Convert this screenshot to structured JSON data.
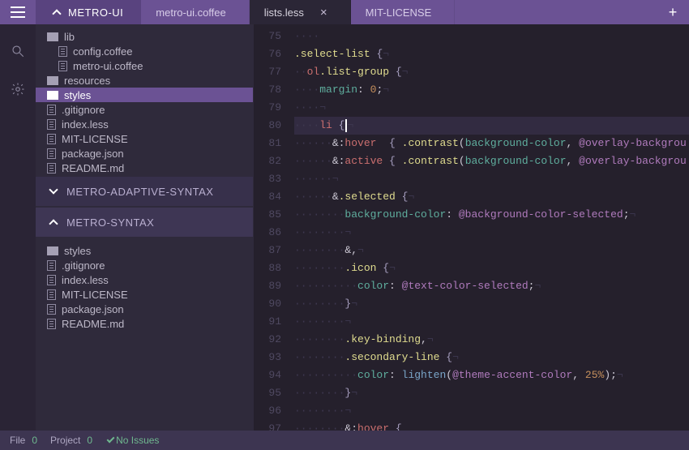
{
  "project": {
    "name": "METRO-UI"
  },
  "tabs": [
    {
      "label": "metro-ui.coffee",
      "active": false,
      "closeable": false
    },
    {
      "label": "lists.less",
      "active": true,
      "closeable": true
    },
    {
      "label": "MIT-LICENSE",
      "active": false,
      "closeable": false
    }
  ],
  "tree_top": [
    {
      "type": "folder",
      "depth": 0,
      "label": "lib"
    },
    {
      "type": "file",
      "depth": 1,
      "label": "config.coffee"
    },
    {
      "type": "file",
      "depth": 1,
      "label": "metro-ui.coffee"
    },
    {
      "type": "folder",
      "depth": 0,
      "label": "resources"
    },
    {
      "type": "folder",
      "depth": 0,
      "label": "styles",
      "selected": true
    },
    {
      "type": "file",
      "depth": 0,
      "label": ".gitignore"
    },
    {
      "type": "file",
      "depth": 0,
      "label": "index.less"
    },
    {
      "type": "file",
      "depth": 0,
      "label": "MIT-LICENSE"
    },
    {
      "type": "file",
      "depth": 0,
      "label": "package.json"
    },
    {
      "type": "file",
      "depth": 0,
      "label": "README.md"
    }
  ],
  "sections": [
    {
      "label": "METRO-ADAPTIVE-SYNTAX",
      "collapsed": true
    },
    {
      "label": "METRO-SYNTAX",
      "collapsed": false
    }
  ],
  "tree_bottom": [
    {
      "type": "folder",
      "depth": 0,
      "label": "styles"
    },
    {
      "type": "file",
      "depth": 0,
      "label": ".gitignore"
    },
    {
      "type": "file",
      "depth": 0,
      "label": "index.less"
    },
    {
      "type": "file",
      "depth": 0,
      "label": "MIT-LICENSE"
    },
    {
      "type": "file",
      "depth": 0,
      "label": "package.json"
    },
    {
      "type": "file",
      "depth": 0,
      "label": "README.md"
    }
  ],
  "editor": {
    "lines": [
      {
        "n": 75,
        "tokens": [
          {
            "t": "inv",
            "v": "····"
          },
          {
            "t": "",
            "v": ""
          }
        ]
      },
      {
        "n": 76,
        "tokens": [
          {
            "t": "cls",
            "v": ".select-list"
          },
          {
            "t": "",
            "v": " "
          },
          {
            "t": "br",
            "v": "{"
          },
          {
            "t": "inv",
            "v": "¬"
          }
        ]
      },
      {
        "n": 77,
        "tokens": [
          {
            "t": "inv",
            "v": "··"
          },
          {
            "t": "tag",
            "v": "ol"
          },
          {
            "t": "cls",
            "v": ".list-group"
          },
          {
            "t": "",
            "v": " "
          },
          {
            "t": "br",
            "v": "{"
          },
          {
            "t": "inv",
            "v": "¬"
          }
        ]
      },
      {
        "n": 78,
        "tokens": [
          {
            "t": "inv",
            "v": "····"
          },
          {
            "t": "prop",
            "v": "margin"
          },
          {
            "t": "",
            "v": ": "
          },
          {
            "t": "num",
            "v": "0"
          },
          {
            "t": "",
            "v": ";"
          },
          {
            "t": "inv",
            "v": "¬"
          }
        ]
      },
      {
        "n": 79,
        "tokens": [
          {
            "t": "inv",
            "v": "····¬"
          }
        ]
      },
      {
        "n": 80,
        "hl": true,
        "tokens": [
          {
            "t": "inv",
            "v": "····"
          },
          {
            "t": "tag",
            "v": "li"
          },
          {
            "t": "",
            "v": " "
          },
          {
            "t": "br",
            "v": "{"
          },
          {
            "t": "cursor",
            "v": ""
          },
          {
            "t": "inv",
            "v": "¬"
          }
        ]
      },
      {
        "n": 81,
        "tokens": [
          {
            "t": "inv",
            "v": "······"
          },
          {
            "t": "",
            "v": "&:"
          },
          {
            "t": "tag",
            "v": "hover"
          },
          {
            "t": "",
            "v": "  "
          },
          {
            "t": "br",
            "v": "{"
          },
          {
            "t": "",
            "v": " "
          },
          {
            "t": "cls",
            "v": ".contrast"
          },
          {
            "t": "",
            "v": "("
          },
          {
            "t": "prop",
            "v": "background-color"
          },
          {
            "t": "",
            "v": ", "
          },
          {
            "t": "var",
            "v": "@overlay-backgrou"
          }
        ]
      },
      {
        "n": 82,
        "tokens": [
          {
            "t": "inv",
            "v": "······"
          },
          {
            "t": "",
            "v": "&:"
          },
          {
            "t": "tag",
            "v": "active"
          },
          {
            "t": "",
            "v": " "
          },
          {
            "t": "br",
            "v": "{"
          },
          {
            "t": "",
            "v": " "
          },
          {
            "t": "cls",
            "v": ".contrast"
          },
          {
            "t": "",
            "v": "("
          },
          {
            "t": "prop",
            "v": "background-color"
          },
          {
            "t": "",
            "v": ", "
          },
          {
            "t": "var",
            "v": "@overlay-backgrou"
          }
        ]
      },
      {
        "n": 83,
        "tokens": [
          {
            "t": "inv",
            "v": "······¬"
          }
        ]
      },
      {
        "n": 84,
        "tokens": [
          {
            "t": "inv",
            "v": "······"
          },
          {
            "t": "",
            "v": "&"
          },
          {
            "t": "cls",
            "v": ".selected"
          },
          {
            "t": "",
            "v": " "
          },
          {
            "t": "br",
            "v": "{"
          },
          {
            "t": "inv",
            "v": "¬"
          }
        ]
      },
      {
        "n": 85,
        "tokens": [
          {
            "t": "inv",
            "v": "········"
          },
          {
            "t": "prop",
            "v": "background-color"
          },
          {
            "t": "",
            "v": ": "
          },
          {
            "t": "var",
            "v": "@background-color-selected"
          },
          {
            "t": "",
            "v": ";"
          },
          {
            "t": "inv",
            "v": "¬"
          }
        ]
      },
      {
        "n": 86,
        "tokens": [
          {
            "t": "inv",
            "v": "········¬"
          }
        ]
      },
      {
        "n": 87,
        "tokens": [
          {
            "t": "inv",
            "v": "········"
          },
          {
            "t": "",
            "v": "&,"
          },
          {
            "t": "inv",
            "v": "¬"
          }
        ]
      },
      {
        "n": 88,
        "tokens": [
          {
            "t": "inv",
            "v": "········"
          },
          {
            "t": "cls",
            "v": ".icon"
          },
          {
            "t": "",
            "v": " "
          },
          {
            "t": "br",
            "v": "{"
          },
          {
            "t": "inv",
            "v": "¬"
          }
        ]
      },
      {
        "n": 89,
        "tokens": [
          {
            "t": "inv",
            "v": "··········"
          },
          {
            "t": "prop",
            "v": "color"
          },
          {
            "t": "",
            "v": ": "
          },
          {
            "t": "var",
            "v": "@text-color-selected"
          },
          {
            "t": "",
            "v": ";"
          },
          {
            "t": "inv",
            "v": "¬"
          }
        ]
      },
      {
        "n": 90,
        "tokens": [
          {
            "t": "inv",
            "v": "········"
          },
          {
            "t": "br",
            "v": "}"
          },
          {
            "t": "inv",
            "v": "¬"
          }
        ]
      },
      {
        "n": 91,
        "tokens": [
          {
            "t": "inv",
            "v": "········¬"
          }
        ]
      },
      {
        "n": 92,
        "tokens": [
          {
            "t": "inv",
            "v": "········"
          },
          {
            "t": "cls",
            "v": ".key-binding"
          },
          {
            "t": "",
            "v": ","
          },
          {
            "t": "inv",
            "v": "¬"
          }
        ]
      },
      {
        "n": 93,
        "tokens": [
          {
            "t": "inv",
            "v": "········"
          },
          {
            "t": "cls",
            "v": ".secondary-line"
          },
          {
            "t": "",
            "v": " "
          },
          {
            "t": "br",
            "v": "{"
          },
          {
            "t": "inv",
            "v": "¬"
          }
        ]
      },
      {
        "n": 94,
        "tokens": [
          {
            "t": "inv",
            "v": "··········"
          },
          {
            "t": "prop",
            "v": "color"
          },
          {
            "t": "",
            "v": ": "
          },
          {
            "t": "fn",
            "v": "lighten"
          },
          {
            "t": "",
            "v": "("
          },
          {
            "t": "var",
            "v": "@theme-accent-color"
          },
          {
            "t": "",
            "v": ", "
          },
          {
            "t": "num",
            "v": "25%"
          },
          {
            "t": "",
            "v": ");"
          },
          {
            "t": "inv",
            "v": "¬"
          }
        ]
      },
      {
        "n": 95,
        "tokens": [
          {
            "t": "inv",
            "v": "········"
          },
          {
            "t": "br",
            "v": "}"
          },
          {
            "t": "inv",
            "v": "¬"
          }
        ]
      },
      {
        "n": 96,
        "tokens": [
          {
            "t": "inv",
            "v": "········¬"
          }
        ]
      },
      {
        "n": 97,
        "tokens": [
          {
            "t": "inv",
            "v": "········"
          },
          {
            "t": "",
            "v": "&:"
          },
          {
            "t": "tag",
            "v": "hover"
          },
          {
            "t": "",
            "v": " "
          },
          {
            "t": "br",
            "v": "{"
          }
        ]
      }
    ]
  },
  "status": {
    "file_label": "File",
    "file_count": "0",
    "project_label": "Project",
    "project_count": "0",
    "issues": "No Issues"
  }
}
